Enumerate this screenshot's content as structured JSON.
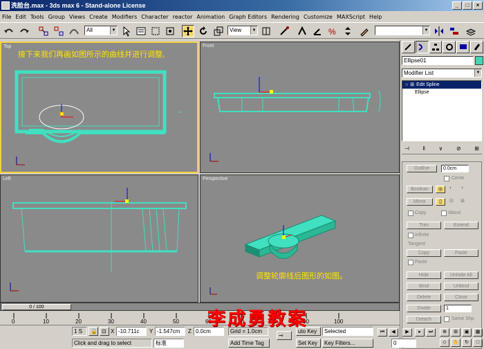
{
  "window": {
    "title": "洗脸台.max - 3ds max 6 - Stand-alone License",
    "btn_min": "_",
    "btn_max": "□",
    "btn_close": "×"
  },
  "menu": [
    "File",
    "Edit",
    "Tools",
    "Group",
    "Views",
    "Create",
    "Modifiers",
    "Character",
    "reactor",
    "Animation",
    "Graph Editors",
    "Rendering",
    "Customize",
    "MAXScript",
    "Help"
  ],
  "toolbar": {
    "selection_filter": "All",
    "ref_coord": "View"
  },
  "viewports": {
    "top": {
      "label": "Top"
    },
    "front": {
      "label": "Front"
    },
    "left": {
      "label": "Left"
    },
    "perspective": {
      "label": "Perspective"
    }
  },
  "annotations": {
    "top": "接下来我们再画如图所示的曲线并进行调整,",
    "perspective": "调整轮廓线后图形的如图。"
  },
  "watermark": "李成勇教案",
  "command_panel": {
    "object_name": "Ellipse01",
    "object_color": "#3fd9b4",
    "modifier_list": "Modifier List",
    "stack": [
      "Edit Spline",
      "Ellipse"
    ],
    "rollout": {
      "outline": "Outline",
      "outline_value": "0.0cm",
      "center": "Cente",
      "boolean": "Boolean",
      "mirror": "Mirror",
      "copy": "Copy",
      "about": "About",
      "trim": "Trim",
      "extend": "Extend",
      "infinite": "Infinite",
      "tangent": "Tangent",
      "t_copy": "Copy",
      "t_paste": "Paste",
      "paste": "Paste",
      "hide": "Hide",
      "unhide_all": "Unhide All",
      "bind": "Bind",
      "unbind": "Unbind",
      "delete": "Delete",
      "close": "Close",
      "divide": "Divide",
      "divide_value": "1",
      "detach": "Detach",
      "same_shp": "Same Shp"
    }
  },
  "timeline": {
    "slider": "0 / 100",
    "ticks": [
      "0",
      "10",
      "20",
      "30",
      "40",
      "50",
      "60",
      "70",
      "80",
      "90",
      "100"
    ]
  },
  "status": {
    "selected_count": "1 S",
    "x_label": "X",
    "x_value": "-10.711c",
    "y_label": "Y",
    "y_value": "-1.547cm",
    "z_label": "Z",
    "z_value": "0.0cm",
    "grid": "Grid = 1.0cm",
    "prompt": "Click and drag to select",
    "ime": "标准",
    "add_time_tag": "Add Time Tag",
    "auto_key": "uto Key",
    "set_key": "Set Key",
    "key_mode": "Selected",
    "key_filters": "Key Filters...",
    "frame": "0"
  }
}
